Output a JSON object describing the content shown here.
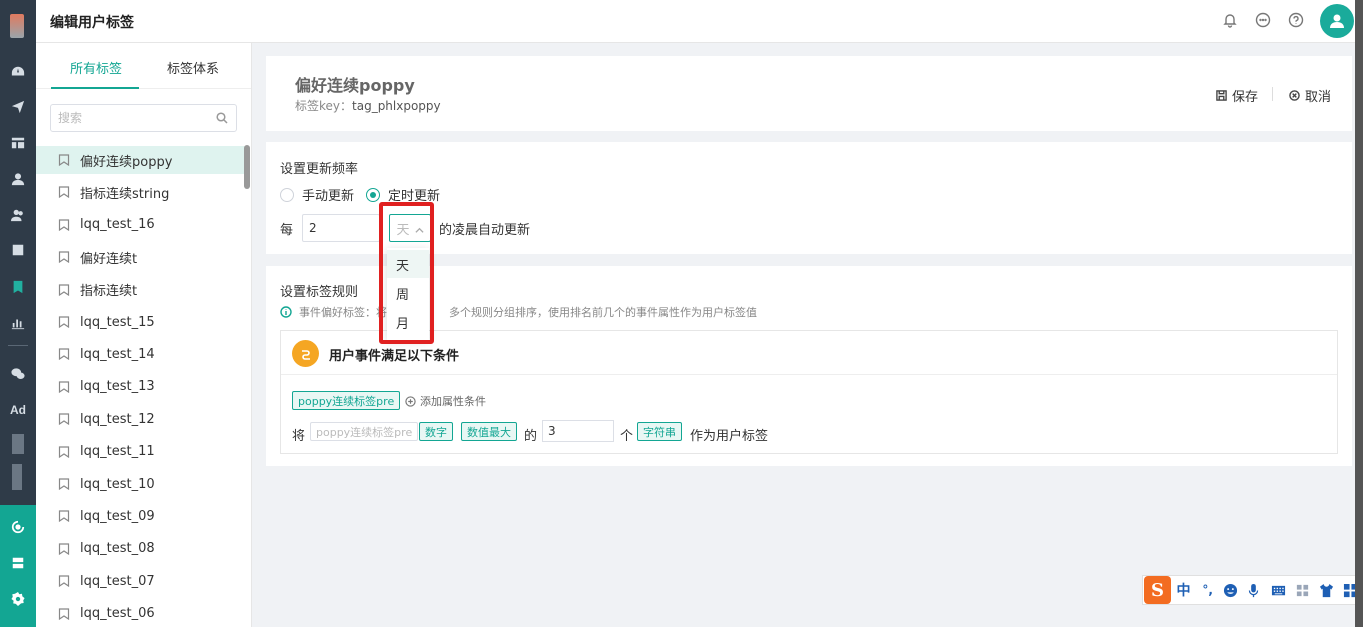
{
  "header": {
    "title": "编辑用户标签"
  },
  "rail": {
    "ad_label": "Ad"
  },
  "tabs": [
    {
      "label": "所有标签"
    },
    {
      "label": "标签体系"
    }
  ],
  "search": {
    "placeholder": "搜索"
  },
  "tag_list": [
    "偏好连续poppy",
    "指标连续string",
    "lqq_test_16",
    "偏好连续t",
    "指标连续t",
    "lqq_test_15",
    "lqq_test_14",
    "lqq_test_13",
    "lqq_test_12",
    "lqq_test_11",
    "lqq_test_10",
    "lqq_test_09",
    "lqq_test_08",
    "lqq_test_07",
    "lqq_test_06"
  ],
  "detail": {
    "name": "偏好连续poppy",
    "key_label": "标签key：",
    "key_value": "tag_phlxpoppy",
    "save_label": "保存",
    "cancel_label": "取消"
  },
  "frequency": {
    "title": "设置更新频率",
    "manual_label": "手动更新",
    "timed_label": "定时更新",
    "selected": "timed",
    "every_label": "每",
    "interval_value": "2",
    "unit_value": "天",
    "after_text": "的凌晨自动更新",
    "unit_options": [
      "天",
      "周",
      "月"
    ]
  },
  "rules": {
    "title": "设置标签规则",
    "info_prefix": "事件偏好标签：将",
    "info_suffix": "多个规则分组排序，使用排名前几个的事件属性作为用户标签值",
    "box_title": "用户事件满足以下条件",
    "event_chip": "poppy连续标签pre",
    "add_condition": "添加属性条件",
    "prefix": "将",
    "placeholder_chip": "poppy连续标签pre",
    "type_chip": "数字",
    "agg_chip": "数值最大",
    "of_label": "的",
    "count_value": "3",
    "count_unit": "个",
    "as_chip": "字符串",
    "suffix": "作为用户标签"
  },
  "ime": {
    "lang": "中",
    "punct": "°,"
  }
}
